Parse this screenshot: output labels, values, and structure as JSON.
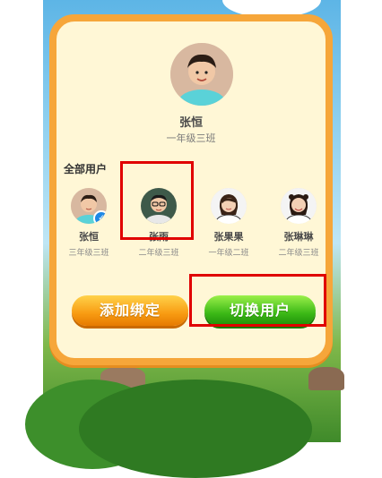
{
  "current_user": {
    "name": "张恒",
    "class": "一年级三班",
    "avatar_icon": "boy-avatar"
  },
  "section_title": "全部用户",
  "users": [
    {
      "name": "张恒",
      "class": "三年级三班",
      "avatar_icon": "boy-avatar",
      "selected": true
    },
    {
      "name": "张雨",
      "class": "二年级三班",
      "avatar_icon": "boy-glasses-avatar",
      "selected": false
    },
    {
      "name": "张果果",
      "class": "一年级二班",
      "avatar_icon": "girl-avatar",
      "selected": false
    },
    {
      "name": "张琳琳",
      "class": "二年级三班",
      "avatar_icon": "girl-avatar",
      "selected": false
    }
  ],
  "buttons": {
    "add_binding": "添加绑定",
    "switch_user": "切换用户"
  },
  "colors": {
    "modal_border": "#f6a63a",
    "modal_bg": "#fff7d6",
    "add_button": "#f89b12",
    "switch_button": "#3bb816",
    "highlight": "#e00000",
    "check_badge": "#1e88e5"
  }
}
